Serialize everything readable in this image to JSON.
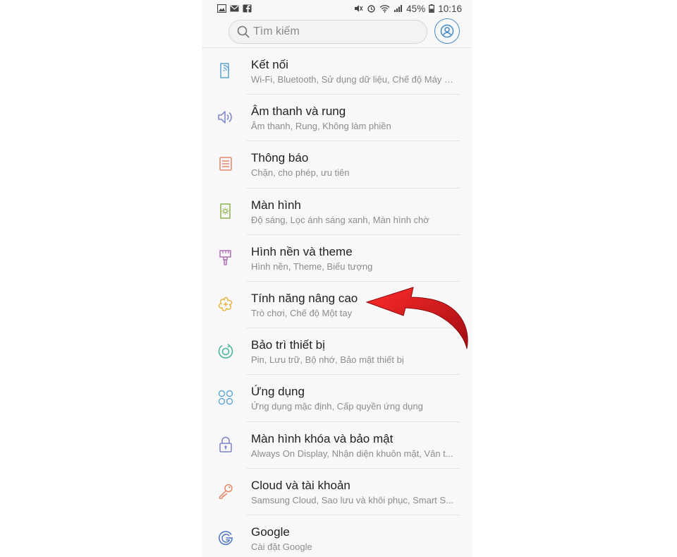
{
  "status_bar": {
    "battery": "45%",
    "time": "10:16",
    "left_icons": [
      "gallery-icon",
      "mail-icon",
      "facebook-icon"
    ],
    "right_icons": [
      "mute-icon",
      "alarm-icon",
      "wifi-icon",
      "signal-icon"
    ]
  },
  "search": {
    "placeholder": "Tìm kiếm"
  },
  "settings": [
    {
      "title": "Kết nối",
      "subtitle": "Wi-Fi, Bluetooth, Sử dụng dữ liệu, Chế độ Máy b...",
      "icon": "connection-icon",
      "color": "#5aa6d6"
    },
    {
      "title": "Âm thanh và rung",
      "subtitle": "Âm thanh, Rung, Không làm phiền",
      "icon": "sound-icon",
      "color": "#7b83c9"
    },
    {
      "title": "Thông báo",
      "subtitle": "Chặn, cho phép, ưu tiên",
      "icon": "notification-icon",
      "color": "#e4876a"
    },
    {
      "title": "Màn hình",
      "subtitle": "Độ sáng, Lọc ánh sáng xanh, Màn hình chờ",
      "icon": "display-icon",
      "color": "#8cb34d"
    },
    {
      "title": "Hình nền và theme",
      "subtitle": "Hình nền, Theme, Biểu tượng",
      "icon": "wallpaper-icon",
      "color": "#b06fb8"
    },
    {
      "title": "Tính năng nâng cao",
      "subtitle": "Trò chơi, Chế độ Một tay",
      "icon": "advanced-features-icon",
      "color": "#e6b53a"
    },
    {
      "title": "Bảo trì thiết bị",
      "subtitle": "Pin, Lưu trữ, Bộ nhớ, Bảo mật thiết bị",
      "icon": "device-maintenance-icon",
      "color": "#46b29a"
    },
    {
      "title": "Ứng dụng",
      "subtitle": "Ứng dụng mặc định, Cấp quyền ứng dụng",
      "icon": "apps-icon",
      "color": "#5aa6d6"
    },
    {
      "title": "Màn hình khóa và bảo mật",
      "subtitle": "Always On Display, Nhận diện khuôn mặt, Vân t...",
      "icon": "lock-icon",
      "color": "#7b83c9"
    },
    {
      "title": "Cloud và tài khoản",
      "subtitle": "Samsung Cloud, Sao lưu và khôi phục, Smart S...",
      "icon": "key-icon",
      "color": "#e4876a"
    },
    {
      "title": "Google",
      "subtitle": "Cài đặt Google",
      "icon": "google-icon",
      "color": "#4a73c4"
    }
  ],
  "annotation": {
    "arrow_color": "#d9141b"
  }
}
